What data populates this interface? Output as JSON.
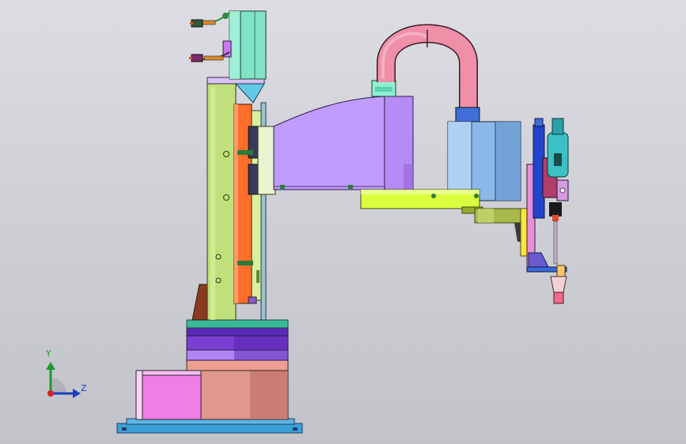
{
  "viewport": {
    "background_top": "#dcdde2",
    "background_bottom": "#c2c3c9"
  },
  "triad": {
    "y_label": "Y",
    "z_label": "Z",
    "y_color": "#1a9b2c",
    "z_color": "#1b3fbf",
    "origin_color": "#d22020"
  },
  "model": {
    "parts": [
      "base-plate",
      "cylinder-base",
      "side-box",
      "column",
      "carriage",
      "motor",
      "cable-connectors",
      "upper-arm",
      "hose",
      "lower-motor",
      "forearm",
      "tool-head",
      "gripper-nozzle"
    ],
    "colors": {
      "base_plate": "#3aa0d8",
      "cylinder_lower": "#e0978c",
      "cylinder_band_purple": "#7a3fd0",
      "cylinder_band_teal": "#3ab89a",
      "side_box": "#ef7ee6",
      "column": "#bfe07a",
      "carriage": "#ff6f2a",
      "motor": "#7fe3c6",
      "upper_arm": "#c19cff",
      "hose": "#ef8fa8",
      "lower_motor": "#8ab8e8",
      "forearm": "#dbff3f",
      "tool_blue": "#2244cc",
      "tool_cyan": "#3bc0c4"
    }
  }
}
